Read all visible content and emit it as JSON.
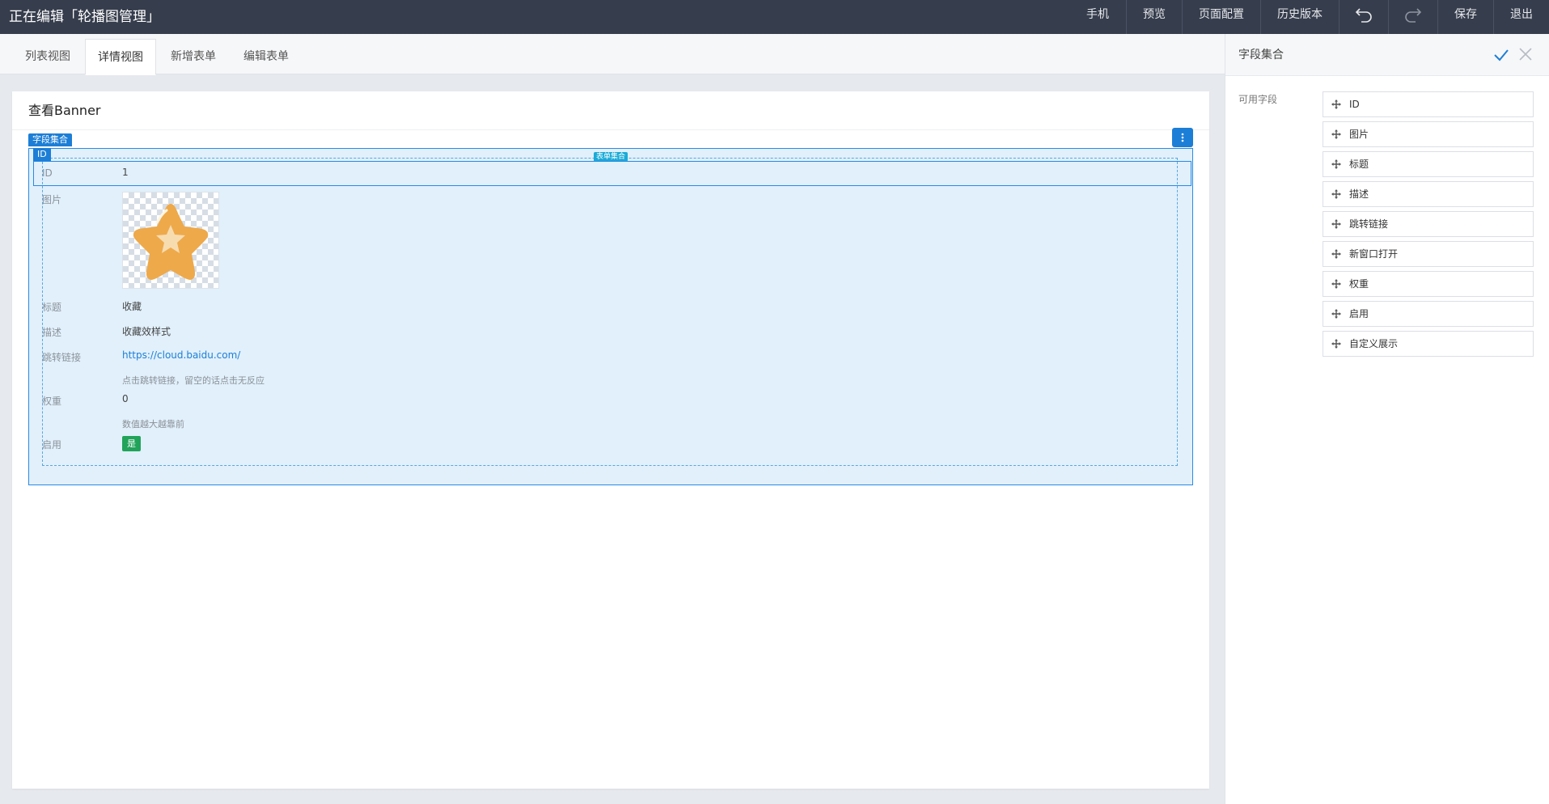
{
  "topbar": {
    "title": "正在编辑「轮播图管理」",
    "actions": [
      "手机",
      "预览",
      "页面配置",
      "历史版本"
    ],
    "save": "保存",
    "exit": "退出"
  },
  "tabs": [
    "列表视图",
    "详情视图",
    "新增表单",
    "编辑表单"
  ],
  "card": {
    "title": "查看Banner",
    "field_set_tag": "字段集合",
    "id_tag": "ID",
    "form_set_tag": "表单集合",
    "rows": {
      "id_label": "ID",
      "id_value": "1",
      "image_label": "图片",
      "title_label": "标题",
      "title_value": "收藏",
      "desc_label": "描述",
      "desc_value": "收藏效样式",
      "link_label": "跳转链接",
      "link_value": "https://cloud.baidu.com/",
      "link_hint": "点击跳转链接，留空的话点击无反应",
      "weight_label": "权重",
      "weight_value": "0",
      "weight_hint": "数值越大越靠前",
      "enabled_label": "启用",
      "enabled_value": "是"
    }
  },
  "panel": {
    "title": "字段集合",
    "available_label": "可用字段",
    "fields": [
      "ID",
      "图片",
      "标题",
      "描述",
      "跳转链接",
      "新窗口打开",
      "权重",
      "启用",
      "自定义展示"
    ]
  },
  "colors": {
    "topbar": "#363d4c",
    "accent": "#1c7ed6",
    "selection_bg": "#e1f0fb",
    "success": "#22a35a"
  }
}
